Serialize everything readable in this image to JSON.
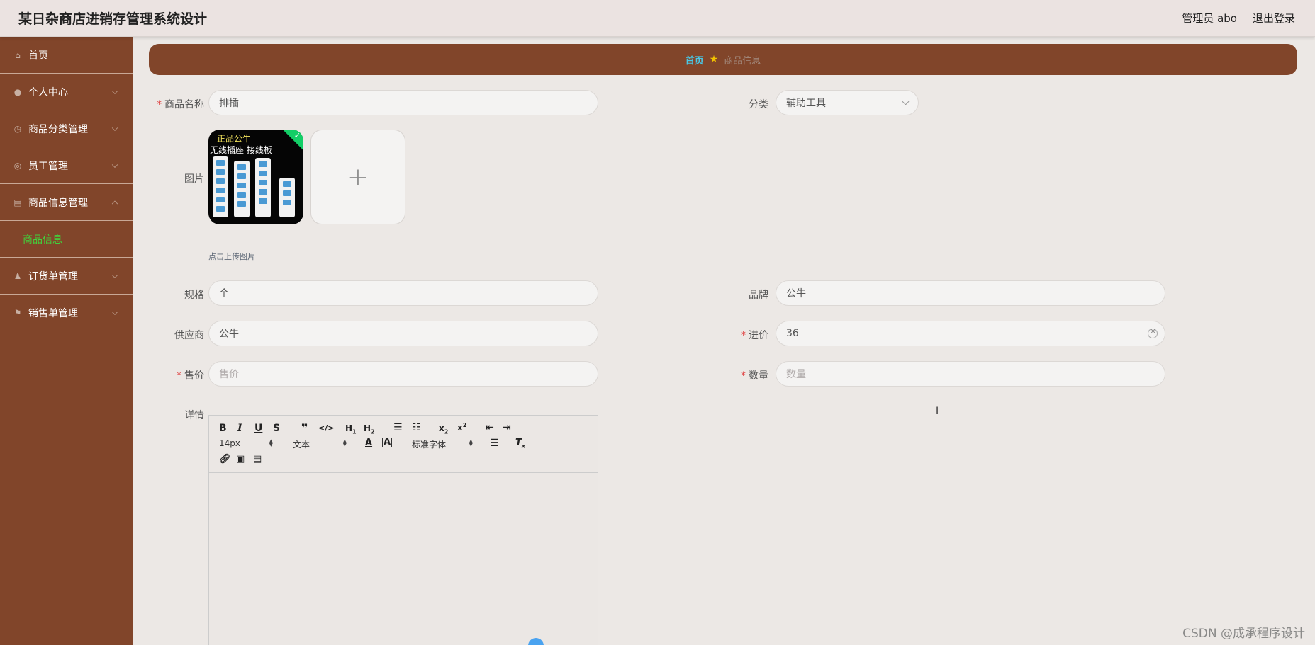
{
  "header": {
    "title": "某日杂商店进销存管理系统设计",
    "user": "管理员 abo",
    "logout": "退出登录"
  },
  "sidebar": {
    "items": [
      {
        "label": "首页",
        "icon": "home-icon"
      },
      {
        "label": "个人中心",
        "icon": "user-icon"
      },
      {
        "label": "商品分类管理",
        "icon": "clock-icon"
      },
      {
        "label": "员工管理",
        "icon": "globe-icon"
      },
      {
        "label": "商品信息管理",
        "icon": "clipboard-icon"
      },
      {
        "label": "订货单管理",
        "icon": "person-icon"
      },
      {
        "label": "销售单管理",
        "icon": "pin-icon"
      }
    ],
    "submenu_active": "商品信息"
  },
  "breadcrumb": {
    "home": "首页",
    "current": "商品信息"
  },
  "form": {
    "name": {
      "label": "商品名称",
      "value": "排插"
    },
    "category": {
      "label": "分类",
      "value": "辅助工具"
    },
    "image": {
      "label": "图片",
      "tip": "点击上传图片",
      "thumb_text1": "正品公牛",
      "thumb_text2": "无线插座 接线板"
    },
    "spec": {
      "label": "规格",
      "value": "个"
    },
    "brand": {
      "label": "品牌",
      "value": "公牛"
    },
    "supplier": {
      "label": "供应商",
      "value": "公牛"
    },
    "purchase_price": {
      "label": "进价",
      "value": "36"
    },
    "sale_price": {
      "label": "售价",
      "placeholder": "售价"
    },
    "quantity": {
      "label": "数量",
      "placeholder": "数量"
    },
    "detail": {
      "label": "详情"
    }
  },
  "editor": {
    "font_size": "14px",
    "text_type": "文本",
    "font_family": "标准字体"
  },
  "watermark": "CSDN @成承程序设计"
}
